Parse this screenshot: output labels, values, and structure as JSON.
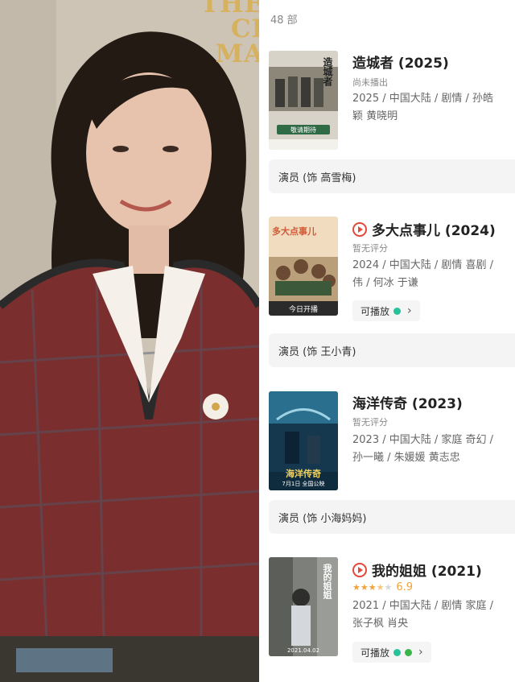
{
  "portrait": {
    "poster_text": [
      "THE",
      "CI",
      "MA"
    ]
  },
  "list": {
    "count": "48 部",
    "entries": [
      {
        "title": "造城者 (2025)",
        "has_play_icon": false,
        "status": "尚未播出",
        "info_lines": [
          "2025 / 中国大陆 / 剧情 / 孙皓",
          "颖 黄晓明"
        ],
        "playable": null,
        "role": "演员 (饰 高雪梅)",
        "poster": {
          "name": "zaochengzhe-poster",
          "title": "造城者",
          "cta": "敬请期待",
          "colors": [
            "#d9d5cc",
            "#8a8477",
            "#3b3a36"
          ]
        }
      },
      {
        "title": "多大点事儿 (2024)",
        "has_play_icon": true,
        "status": "暂无评分",
        "info_lines": [
          "2024 / 中国大陆 / 剧情 喜剧 / ",
          "伟 / 何冰 于谦"
        ],
        "playable": {
          "label": "可播放",
          "icons": [
            "#27c29a"
          ]
        },
        "role": "演员 (饰 王小青)",
        "poster": {
          "name": "duodadianshier-poster",
          "title": "多大点事儿",
          "cta": "今日开播",
          "colors": [
            "#f4e1c4",
            "#d05b35",
            "#3c5a3a"
          ]
        }
      },
      {
        "title": "海洋传奇 (2023)",
        "has_play_icon": false,
        "status": "暂无评分",
        "info_lines": [
          "2023 / 中国大陆 / 家庭 奇幻 / ",
          "孙一曦 / 朱媛媛 黄志忠"
        ],
        "playable": null,
        "role": "演员 (饰 小海妈妈)",
        "poster": {
          "name": "haiyangchuanqi-poster",
          "title": "海洋传奇",
          "cta": "7月1日 全国公映",
          "colors": [
            "#1a3f5c",
            "#2b6f8f",
            "#0d2235"
          ]
        }
      },
      {
        "title": "我的姐姐 (2021)",
        "has_play_icon": true,
        "status": "",
        "rating": {
          "value": 3.5,
          "max": 5,
          "text": "6.9"
        },
        "info_lines": [
          "2021 / 中国大陆 / 剧情 家庭 / ",
          "张子枫 肖央"
        ],
        "playable": {
          "label": "可播放",
          "icons": [
            "#27c29a",
            "#39b54a"
          ]
        },
        "role": "",
        "poster": {
          "name": "wodejiejie-poster",
          "title": "我的姐姐",
          "cta": "2021.04.02",
          "colors": [
            "#6c6e6a",
            "#9a9c98",
            "#2e2f2d"
          ]
        }
      }
    ]
  },
  "colors": {
    "accent": "#e5483a",
    "star": "#f1a33b",
    "star_empty": "#d7d7d7"
  }
}
